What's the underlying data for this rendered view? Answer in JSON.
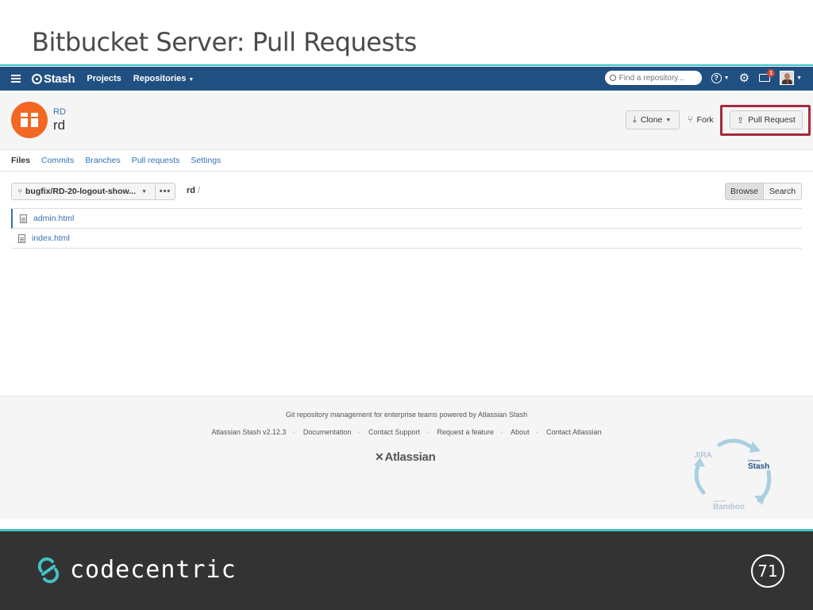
{
  "slide": {
    "title": "Bitbucket Server: Pull Requests",
    "page_number": "71",
    "brand": "codecentric"
  },
  "header": {
    "logo": "Stash",
    "nav": [
      {
        "label": "Projects"
      },
      {
        "label": "Repositories"
      }
    ],
    "search_placeholder": "Find a repository...",
    "notification_count": "1"
  },
  "repo": {
    "project": "RD",
    "name": "rd",
    "actions": {
      "clone": "Clone",
      "fork": "Fork",
      "pull_request": "Pull Request"
    }
  },
  "tabs": [
    {
      "label": "Files",
      "active": true
    },
    {
      "label": "Commits"
    },
    {
      "label": "Branches"
    },
    {
      "label": "Pull requests"
    },
    {
      "label": "Settings"
    }
  ],
  "browser": {
    "branch": "bugfix/RD-20-logout-show...",
    "more": "•••",
    "path_root": "rd",
    "path_sep": "/",
    "browse_label": "Browse",
    "search_label": "Search"
  },
  "files": [
    {
      "name": "admin.html"
    },
    {
      "name": "index.html"
    }
  ],
  "footer": {
    "tagline": "Git repository management for enterprise teams powered by Atlassian Stash",
    "links": [
      "Atlassian Stash v2.12.3",
      "Documentation",
      "Contact Support",
      "Request a feature",
      "About",
      "Contact Atlassian"
    ],
    "atlassian_logo": "Atlassian",
    "cycle": {
      "jira": "JIRA",
      "stash": "Stash",
      "bamboo": "Bamboo",
      "small": "Atlassian"
    }
  },
  "colors": {
    "header_bg": "#205081",
    "accent_teal": "#44c2c5",
    "highlight_red": "#a52a3f",
    "repo_avatar": "#f26722",
    "link_blue": "#3572b0"
  },
  "icons": [
    "hamburger-icon",
    "stash-logo-icon",
    "search-icon",
    "help-icon",
    "gear-icon",
    "inbox-icon",
    "avatar",
    "repo-box-icon",
    "download-icon",
    "fork-icon",
    "share-icon",
    "branch-icon",
    "file-icon",
    "atlassian-logo",
    "codecentric-logo"
  ]
}
